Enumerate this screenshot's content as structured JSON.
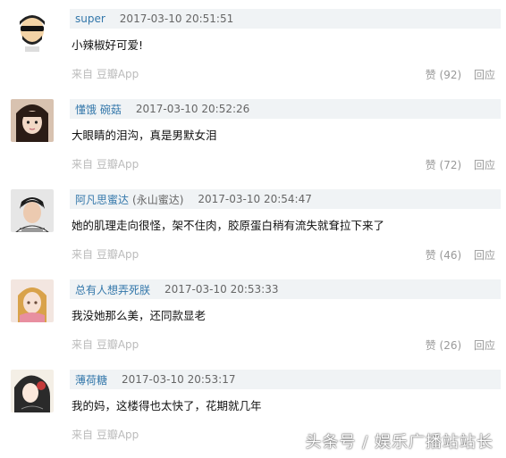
{
  "comments": [
    {
      "user": "super",
      "handle": "",
      "time": "2017-03-10 20:51:51",
      "text": "小辣椒好可爱!",
      "source_prefix": "来自",
      "source_app": "豆瓣App",
      "likes_label": "赞 (92)",
      "reply_label": "回应",
      "avatar": "bearded-man-icon"
    },
    {
      "user": "懂饿 碗菇",
      "handle": "",
      "time": "2017-03-10 20:52:26",
      "text": "大眼睛的泪沟，真是男默女泪",
      "source_prefix": "来自",
      "source_app": "豆瓣App",
      "likes_label": "赞 (72)",
      "reply_label": "回应",
      "avatar": "girl-photo"
    },
    {
      "user": "阿凡思蜜达",
      "handle": "(永山蜜达)",
      "time": "2017-03-10 20:54:47",
      "text": "她的肌理走向很怪，架不住肉，胶原蛋白稍有流失就耷拉下来了",
      "source_prefix": "来自",
      "source_app": "豆瓣App",
      "likes_label": "赞 (46)",
      "reply_label": "回应",
      "avatar": "boy-photo"
    },
    {
      "user": "总有人想弄死朕",
      "handle": "",
      "time": "2017-03-10 20:53:33",
      "text": "我没她那么美，还同款显老",
      "source_prefix": "来自",
      "source_app": "豆瓣App",
      "likes_label": "赞 (26)",
      "reply_label": "回应",
      "avatar": "anime-photo"
    },
    {
      "user": "薄荷糖",
      "handle": "",
      "time": "2017-03-10 20:53:17",
      "text": "我的妈，这楼得也太快了，花期就几年",
      "source_prefix": "来自",
      "source_app": "豆瓣App",
      "likes_label": "",
      "reply_label": "",
      "avatar": "illustration-photo"
    }
  ],
  "watermark": "头条号 / 娱乐广播站站长"
}
